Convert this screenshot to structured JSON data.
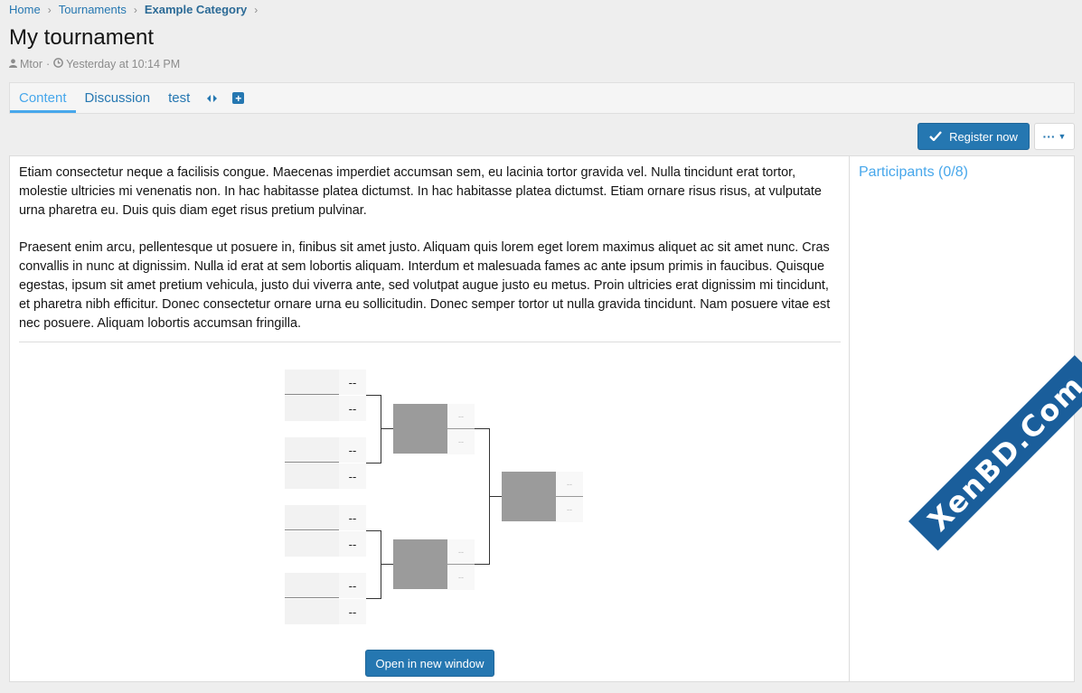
{
  "breadcrumb": [
    {
      "label": "Home"
    },
    {
      "label": "Tournaments"
    },
    {
      "label": "Example Category"
    }
  ],
  "page": {
    "title": "My tournament",
    "author": "Mtor",
    "timestamp": "Yesterday at 10:14 PM"
  },
  "tabs": [
    {
      "label": "Content",
      "active": true
    },
    {
      "label": "Discussion"
    },
    {
      "label": "test"
    }
  ],
  "actions": {
    "register_label": "Register now",
    "more_label": "···"
  },
  "content": {
    "paragraphs": [
      "Etiam consectetur neque a facilisis congue. Maecenas imperdiet accumsan sem, eu lacinia tortor gravida vel. Nulla tincidunt erat tortor, molestie ultricies mi venenatis non. In hac habitasse platea dictumst. In hac habitasse platea dictumst. Etiam ornare risus risus, at vulputate urna pharetra eu. Duis quis diam eget risus pretium pulvinar.",
      "Praesent enim arcu, pellentesque ut posuere in, finibus sit amet justo. Aliquam quis lorem eget lorem maximus aliquet ac sit amet nunc. Cras convallis in nunc at dignissim. Nulla id erat at sem lobortis aliquam. Interdum et malesuada fames ac ante ipsum primis in faucibus. Quisque egestas, ipsum sit amet pretium vehicula, justo dui viverra ante, sed volutpat augue justo eu metus. Proin ultricies erat dignissim mi tincidunt, et pharetra nibh efficitur. Donec consectetur ornare urna eu sollicitudin. Donec semper tortor ut nulla gravida tincidunt. Nam posuere vitae est nec posuere. Aliquam lobortis accumsan fringilla."
    ]
  },
  "bracket": {
    "round1_scores": [
      "--",
      "--",
      "--",
      "--",
      "--",
      "--",
      "--",
      "--"
    ],
    "round2_scores": [
      "--",
      "--",
      "--",
      "--"
    ],
    "final_scores": [
      "--",
      "--"
    ],
    "open_label": "Open in new window"
  },
  "sidebar": {
    "participants_label": "Participants (0/8)"
  },
  "watermark": {
    "text": "XenBD.Com"
  },
  "colors": {
    "accent": "#2577b1",
    "active_tab": "#47a7eb"
  }
}
